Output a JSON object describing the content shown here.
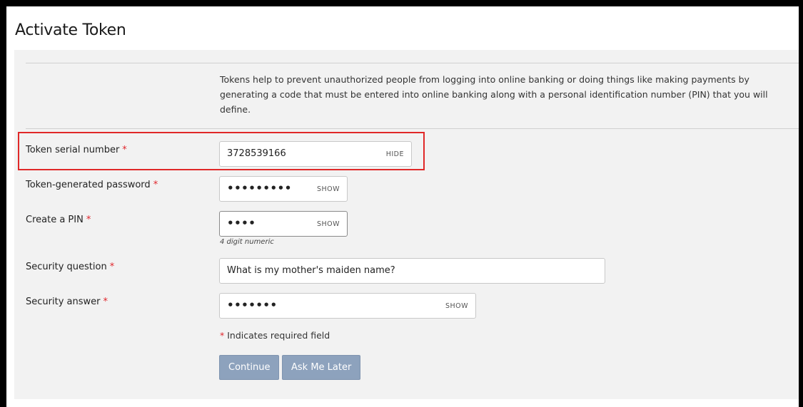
{
  "page": {
    "title": "Activate Token",
    "intro": "Tokens help to prevent unauthorized people from logging into online banking or doing things like making payments by generating a code that must be entered into online banking along with a personal identification number (PIN) that you will define."
  },
  "fields": {
    "serial": {
      "label": "Token serial number",
      "value": "3728539166",
      "toggle": "HIDE"
    },
    "password": {
      "label": "Token-generated password",
      "value": "•••••••••",
      "toggle": "SHOW"
    },
    "pin": {
      "label": "Create a PIN",
      "value": "••••",
      "toggle": "SHOW",
      "hint": "4 digit numeric"
    },
    "question": {
      "label": "Security question",
      "value": "What is my mother's maiden name?"
    },
    "answer": {
      "label": "Security answer",
      "value": "•••••••",
      "toggle": "SHOW"
    }
  },
  "required": {
    "marker": "*",
    "note": "Indicates required field"
  },
  "actions": {
    "continue": "Continue",
    "later": "Ask Me Later"
  },
  "colors": {
    "required_marker": "#e0262c",
    "highlight_box": "#e02828",
    "button_bg": "#8da2bd",
    "panel_bg": "#f2f2f2"
  }
}
